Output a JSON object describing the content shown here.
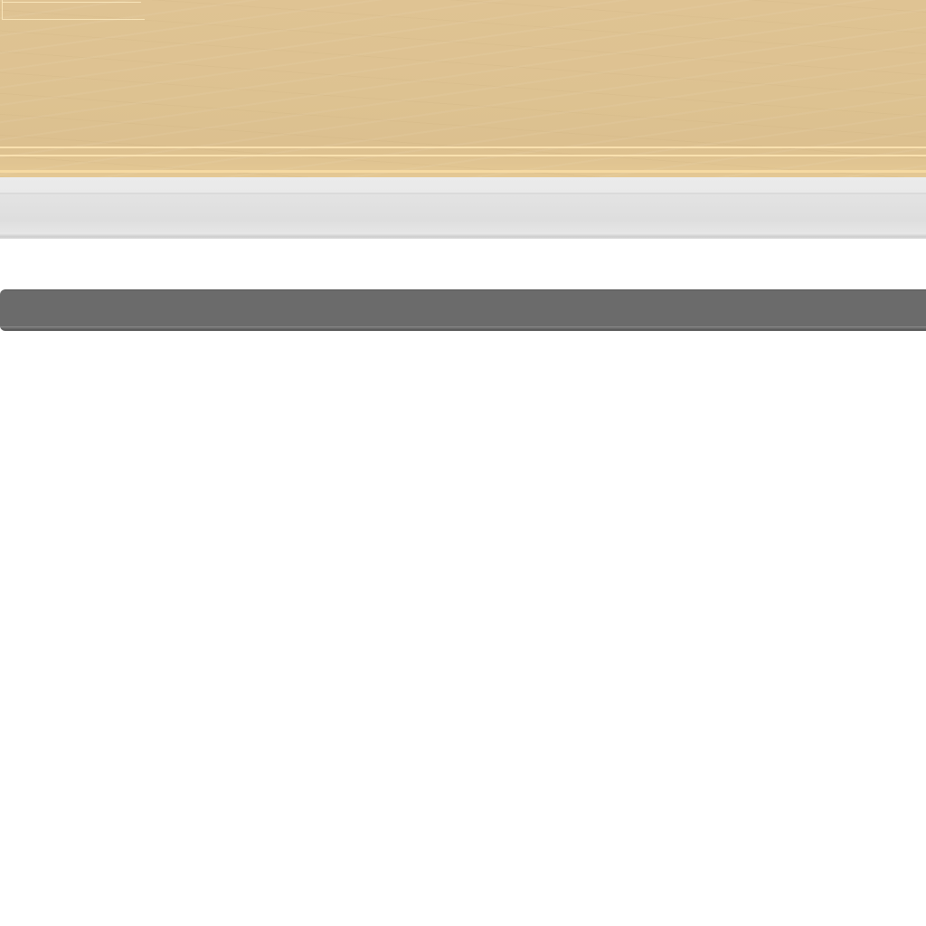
{
  "colors": {
    "header_background": "#ddc291",
    "header_trim": "#fae2b0",
    "toolbar_background": "#e3e3e3",
    "dark_bar_background": "#6b6b6b",
    "content_background": "#ffffff"
  }
}
